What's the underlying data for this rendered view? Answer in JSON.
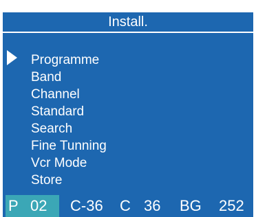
{
  "header": {
    "title": "Install."
  },
  "menu": {
    "items": [
      {
        "label": "Programme",
        "selected": true
      },
      {
        "label": "Band"
      },
      {
        "label": "Channel"
      },
      {
        "label": "Standard"
      },
      {
        "label": "Search"
      },
      {
        "label": "Fine Tunning"
      },
      {
        "label": "Vcr Mode"
      },
      {
        "label": "Store"
      }
    ]
  },
  "status": {
    "prog_prefix": "P",
    "prog_number": "02",
    "channel_code": "C-36",
    "channel_prefix": "C",
    "channel_number": "36",
    "standard": "BG",
    "frequency": "252"
  },
  "colors": {
    "panel_bg": "#1d67b0",
    "highlight_bg": "#3ba7b6",
    "text": "#ffffff"
  }
}
